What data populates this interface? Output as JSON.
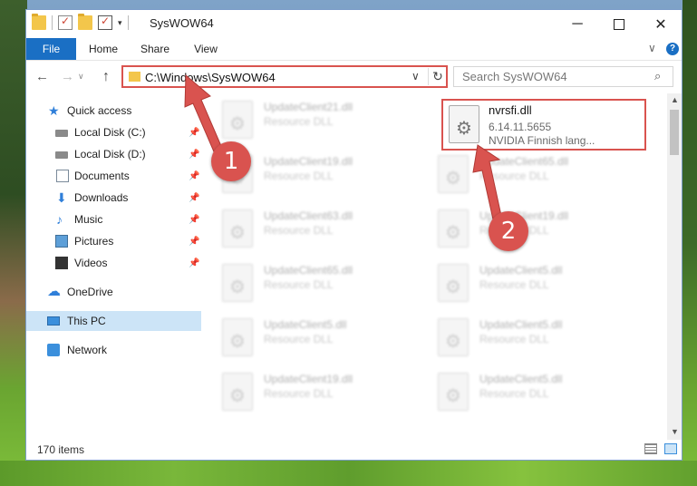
{
  "window": {
    "title": "SysWOW64",
    "controls": {
      "minimize": "─",
      "maximize": "",
      "close": "✕"
    },
    "qat_dropdown": "▾"
  },
  "ribbon": {
    "tabs": [
      "File",
      "Home",
      "Share",
      "View"
    ],
    "expand_chevron": "∨",
    "help": "?"
  },
  "nav": {
    "back": "←",
    "forward": "→",
    "history": "∨",
    "up": "↑",
    "address": "C:\\Windows\\SysWOW64",
    "address_chevron": "∨",
    "refresh": "↻",
    "search_placeholder": "Search SysWOW64",
    "search_icon": "⌕"
  },
  "sidebar": {
    "items": [
      {
        "label": "Quick access",
        "icon": "star-icon",
        "pinned": false
      },
      {
        "label": "Local Disk (C:)",
        "icon": "drive-icon",
        "pinned": true
      },
      {
        "label": "Local Disk (D:)",
        "icon": "drive-icon",
        "pinned": true
      },
      {
        "label": "Documents",
        "icon": "documents-icon",
        "pinned": true
      },
      {
        "label": "Downloads",
        "icon": "downloads-icon",
        "pinned": true
      },
      {
        "label": "Music",
        "icon": "music-icon",
        "pinned": true
      },
      {
        "label": "Pictures",
        "icon": "pictures-icon",
        "pinned": true
      },
      {
        "label": "Videos",
        "icon": "videos-icon",
        "pinned": true
      },
      {
        "label": "OneDrive",
        "icon": "onedrive-icon",
        "pinned": false
      },
      {
        "label": "This PC",
        "icon": "pc-icon",
        "pinned": false,
        "selected": true
      },
      {
        "label": "Network",
        "icon": "network-icon",
        "pinned": false
      }
    ],
    "pin_glyph": "📌"
  },
  "files": {
    "highlighted": {
      "name": "nvrsfi.dll",
      "version": "6.14.11.5655",
      "description": "NVIDIA Finnish lang..."
    },
    "left_column": [
      {
        "name": "UpdateClient21.dll",
        "desc": "Resource DLL"
      },
      {
        "name": "UpdateClient19.dll",
        "desc": "Resource DLL"
      },
      {
        "name": "UpdateClient63.dll",
        "desc": "Resource DLL"
      },
      {
        "name": "UpdateClient65.dll",
        "desc": "Resource DLL"
      },
      {
        "name": "UpdateClient5.dll",
        "desc": "Resource DLL"
      },
      {
        "name": "UpdateClient19.dll",
        "desc": "Resource DLL"
      }
    ],
    "right_column": [
      {
        "name": "UpdateClient65.dll",
        "desc": "Resource DLL"
      },
      {
        "name": "UpdateClient19.dll",
        "desc": "Resource DLL"
      },
      {
        "name": "UpdateClient5.dll",
        "desc": "Resource DLL"
      },
      {
        "name": "UpdateClient5.dll",
        "desc": "Resource DLL"
      },
      {
        "name": "UpdateClient5.dll",
        "desc": "Resource DLL"
      }
    ]
  },
  "status": {
    "item_count": "170 items"
  },
  "annotations": {
    "step1": "1",
    "step2": "2",
    "color": "#d9534f"
  }
}
